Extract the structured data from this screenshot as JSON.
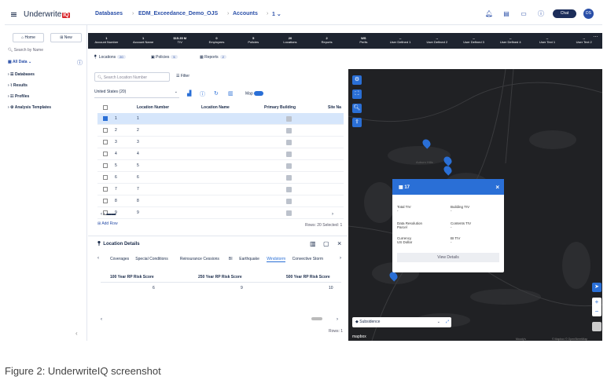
{
  "app": {
    "brand": "Underwrite",
    "brand_badge": "IQ"
  },
  "breadcrumb": [
    "Databases",
    "EDM_Exceedance_Demo_OJS",
    "Accounts",
    "1"
  ],
  "header": {
    "chat_label": "Chat",
    "user_initials": "DS"
  },
  "sidebar": {
    "home": "Home",
    "new": "New",
    "search_placeholder": "Search by Name",
    "filter": "All Data",
    "items": [
      "Databases",
      "Results",
      "Profiles",
      "Analysis Templates"
    ]
  },
  "stats": [
    {
      "v": "1",
      "l": "Account Number"
    },
    {
      "v": "1",
      "l": "Account Name"
    },
    {
      "v": "$15.35 M",
      "l": "TIV"
    },
    {
      "v": "0",
      "l": "Employees"
    },
    {
      "v": "5",
      "l": "Policies"
    },
    {
      "v": "20",
      "l": "Locations"
    },
    {
      "v": "2",
      "l": "Reports"
    },
    {
      "v": "WS",
      "l": "Perils"
    },
    {
      "v": "--",
      "l": "User Defined 1"
    },
    {
      "v": "--",
      "l": "User Defined 2"
    },
    {
      "v": "--",
      "l": "User Defined 3"
    },
    {
      "v": "--",
      "l": "User Defined 4"
    },
    {
      "v": "--",
      "l": "User Text 1"
    },
    {
      "v": "--",
      "l": "User Text 2"
    }
  ],
  "tabs": [
    {
      "label": "Locations",
      "count": "20"
    },
    {
      "label": "Policies",
      "count": "5"
    },
    {
      "label": "Reports",
      "count": "2"
    }
  ],
  "grid": {
    "search_placeholder": "Search Location Number",
    "filter_label": "Filter",
    "country": "United States (20)",
    "map_toggle": "Map",
    "headers": [
      "Location Number",
      "Location Name",
      "Primary Building",
      "Site Na"
    ],
    "rows": [
      "1",
      "2",
      "3",
      "4",
      "5",
      "6",
      "7",
      "8",
      "9"
    ],
    "add_row": "Add Row",
    "rows_footer": "Rows: 20 Selected: 1"
  },
  "details": {
    "title": "Location Details",
    "tabs": [
      "Coverages",
      "Special Conditions",
      "Reinsurance Cessions",
      "BI",
      "Earthquake",
      "Windstorm",
      "Convective Storm"
    ],
    "active_tab": "Windstorm",
    "cols": [
      "100 Year RP Risk Score",
      "250 Year RP Risk Score",
      "500 Year RP Risk Score"
    ],
    "vals": [
      "6",
      "9",
      "10"
    ],
    "rows_footer": "Rows: 1"
  },
  "popup": {
    "id": "17",
    "f1l": "Total TIV",
    "f1v": "-",
    "f2l": "Building TIV",
    "f2v": "-",
    "f3l": "Data Resolution",
    "f3v": "Parcel",
    "f4l": "Contents TIV",
    "f4v": "-",
    "f5l": "Currency",
    "f5v": "US Dollar",
    "f6l": "BI TIV",
    "f6v": "-",
    "button": "View Details"
  },
  "map": {
    "layer": "Subsidence",
    "attribution": "mapbox",
    "copyright": "© Mapbox © OpenStreetMap",
    "moodys": "Moody's"
  },
  "caption": "Figure 2: UnderwriteIQ screenshot"
}
